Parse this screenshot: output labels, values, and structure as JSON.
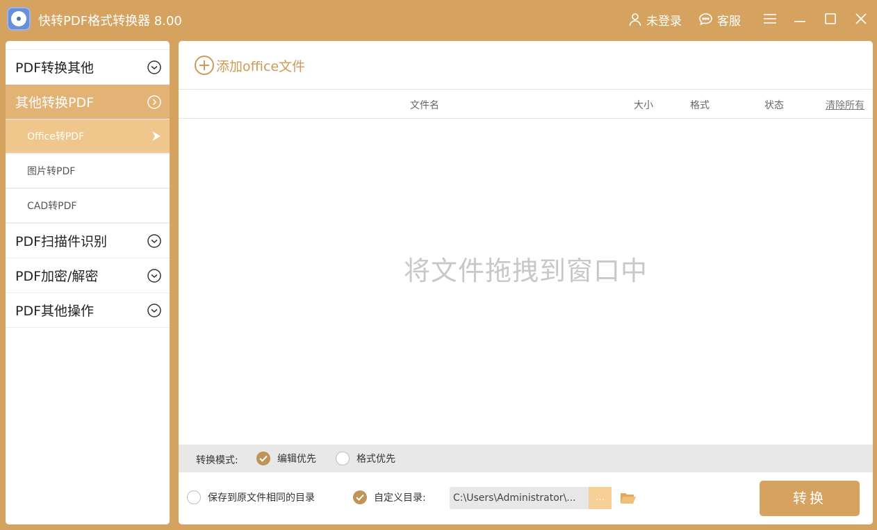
{
  "app": {
    "title": "快转PDF格式转换器 8.00"
  },
  "titlebar": {
    "login_label": "未登录",
    "service_label": "客服"
  },
  "sidebar": {
    "groups": [
      {
        "label": "PDF转换其他"
      },
      {
        "label": "其他转换PDF",
        "subitems": [
          "Office转PDF",
          "图片转PDF",
          "CAD转PDF"
        ]
      },
      {
        "label": "PDF扫描件识别"
      },
      {
        "label": "PDF加密/解密"
      },
      {
        "label": "PDF其他操作"
      }
    ]
  },
  "main": {
    "add_file_label": "添加office文件",
    "columns": {
      "name": "文件名",
      "size": "大小",
      "format": "格式",
      "status": "状态",
      "clear_all": "清除所有"
    },
    "drop_hint": "将文件拖拽到窗口中",
    "mode": {
      "label": "转换模式:",
      "option_edit": "编辑优先",
      "option_format": "格式优先",
      "selected": "编辑优先"
    },
    "output": {
      "same_dir_label": "保存到原文件相同的目录",
      "custom_dir_label": "自定义目录:",
      "path": "C:\\Users\\Administrator\\...",
      "browse_label": "...",
      "selected": "自定义目录"
    },
    "convert_label": "转换"
  },
  "colors": {
    "accent": "#d6a25f",
    "sidebar_active": "#e2b375",
    "sub_active": "#efc78d",
    "check": "#bf9456"
  }
}
